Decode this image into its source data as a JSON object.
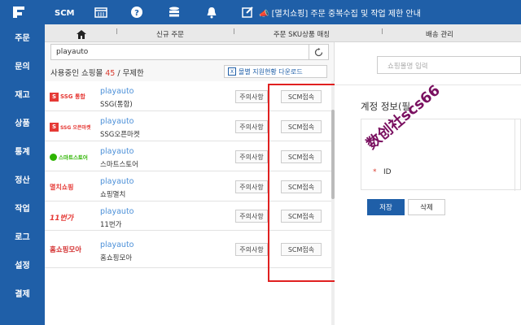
{
  "topbar": {
    "scm_label": "SCM",
    "notice": "[멸치쇼핑] 주문 중복수집 및 작업 제한 안내",
    "accent": "#1f5fa8"
  },
  "sidebar": {
    "items": [
      {
        "label": "주문"
      },
      {
        "label": "문의"
      },
      {
        "label": "재고"
      },
      {
        "label": "상품"
      },
      {
        "label": "통계"
      },
      {
        "label": "정산"
      },
      {
        "label": "작업"
      },
      {
        "label": "로그"
      },
      {
        "label": "설정"
      },
      {
        "label": "결제"
      }
    ]
  },
  "tabs": [
    {
      "label": "신규 주문"
    },
    {
      "label": "주문 SKU상품 매칭"
    },
    {
      "label": "배송 관리"
    }
  ],
  "shop_panel": {
    "search_value": "playauto",
    "summary_prefix": "사용중인 쇼핑몰 ",
    "summary_count": "45",
    "summary_suffix": " / 무제한",
    "download_label": "몰별 지원현황 다운로드",
    "warn_label": "주의사항",
    "scm_label": "SCM접속",
    "rows": [
      {
        "logo": "SSG 통합",
        "logo_color": "#e53935",
        "name": "playauto",
        "market": "SSG(통합)"
      },
      {
        "logo": "SSG 오픈마켓",
        "logo_color": "#e53935",
        "name": "playauto",
        "market": "SSG오픈마켓"
      },
      {
        "logo": "스마트스토어",
        "logo_color": "#2db400",
        "name": "playauto",
        "market": "스마트스토어"
      },
      {
        "logo": "멸치쇼핑",
        "logo_color": "#e53935",
        "name": "playauto",
        "market": "쇼핑멸치"
      },
      {
        "logo": "11번가",
        "logo_color": "#e53935",
        "name": "playauto",
        "market": "11번가"
      },
      {
        "logo": "홈쇼핑모아",
        "logo_color": "#d32f2f",
        "name": "playauto",
        "market": "홈쇼핑모아"
      }
    ]
  },
  "right_panel": {
    "search_placeholder": "쇼핑몰명 입력",
    "account_title": "계정 정보(필",
    "id_label": "ID",
    "required_mark": "*",
    "save_label": "저장",
    "delete_label": "삭제"
  },
  "watermark": "数创社scs66"
}
